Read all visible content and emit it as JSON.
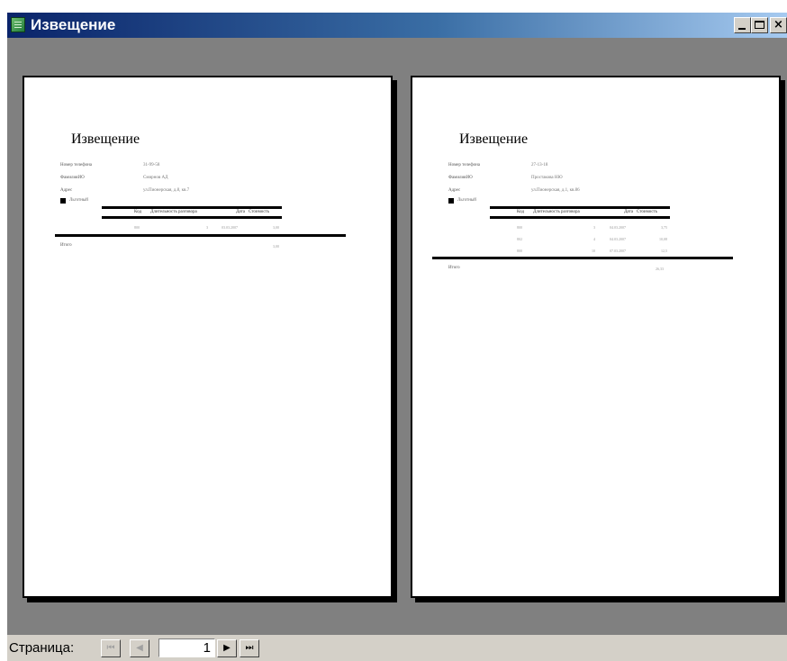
{
  "window": {
    "title": "Извещение"
  },
  "controls": {
    "minimize": "_",
    "close": "×"
  },
  "statusbar": {
    "page_label": "Страница:",
    "page_value": "1",
    "first_icon": "⏮",
    "prev_icon": "◀",
    "next_icon": "▶",
    "last_icon": "⏭"
  },
  "pages": [
    {
      "title": "Извещение",
      "fields": [
        {
          "label": "Номер телефона",
          "value": "31-99-58"
        },
        {
          "label": "ФамилияИО",
          "value": "Смирнов АД"
        },
        {
          "label": "Адрес",
          "value": "ул.Пионерская, д.8, кв.7"
        }
      ],
      "checkbox_label": "Льготный",
      "headers": [
        "Код",
        "Длительность разговора",
        "Дата",
        "Стоимость"
      ],
      "rows": [
        [
          "800",
          "3",
          "03.03.2007",
          "3,00"
        ]
      ],
      "total_label": "Итого",
      "total_value": "3,00"
    },
    {
      "title": "Извещение",
      "fields": [
        {
          "label": "Номер телефона",
          "value": "27-13-18"
        },
        {
          "label": "ФамилияИО",
          "value": "Простакова НЮ"
        },
        {
          "label": "Адрес",
          "value": "ул.Пионерская, д.1, кв.86"
        }
      ],
      "checkbox_label": "Льготный",
      "headers": [
        "Код",
        "Длительность разговора",
        "Дата",
        "Стоимость"
      ],
      "rows": [
        [
          "800",
          "3",
          "04.03.2007",
          "3,75"
        ],
        [
          "802",
          "4",
          "04.03.2007",
          "10,08"
        ],
        [
          "800",
          "10",
          "07.03.2007",
          "12,5"
        ]
      ],
      "total_label": "Итого",
      "total_value": "26,33"
    }
  ]
}
